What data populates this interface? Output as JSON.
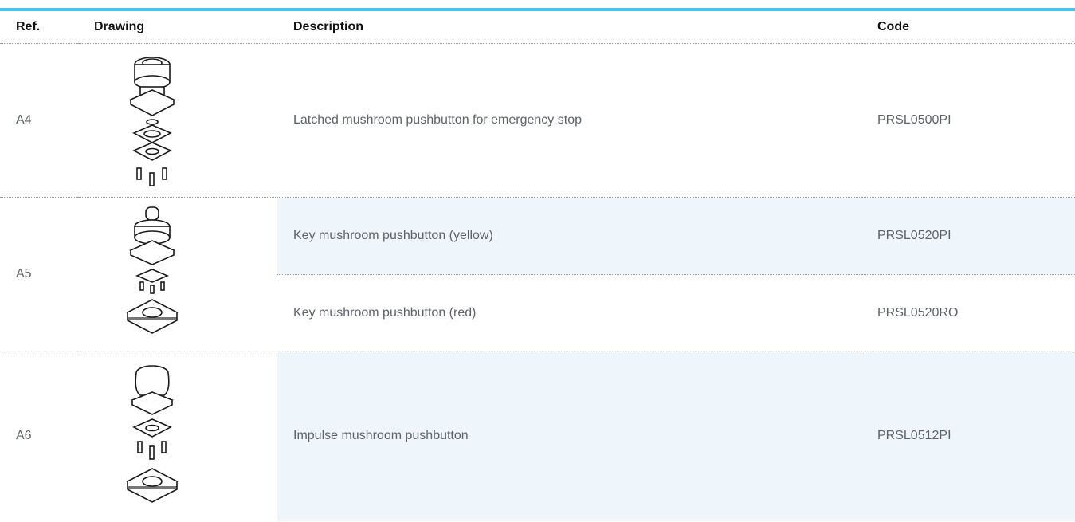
{
  "table": {
    "headers": {
      "ref": "Ref.",
      "drawing": "Drawing",
      "description": "Description",
      "code": "Code"
    },
    "rows": [
      {
        "ref": "A4",
        "drawing_icon": "latched-mushroom-pushbutton-drawing",
        "items": [
          {
            "description": "Latched mushroom pushbutton for emergency stop",
            "code": "PRSL0500PI"
          }
        ]
      },
      {
        "ref": "A5",
        "drawing_icon": "key-mushroom-pushbutton-drawing",
        "items": [
          {
            "description": "Key mushroom pushbutton (yellow)",
            "code": "PRSL0520PI"
          },
          {
            "description": "Key mushroom pushbutton (red)",
            "code": "PRSL0520RO"
          }
        ]
      },
      {
        "ref": "A6",
        "drawing_icon": "impulse-mushroom-pushbutton-drawing",
        "items": [
          {
            "description": "Impulse mushroom pushbutton",
            "code": "PRSL0512PI"
          }
        ]
      }
    ]
  },
  "colors": {
    "accent": "#49c3ea",
    "row_shade": "#eef6fb",
    "text": "#5f6368",
    "header_text": "#111111"
  }
}
